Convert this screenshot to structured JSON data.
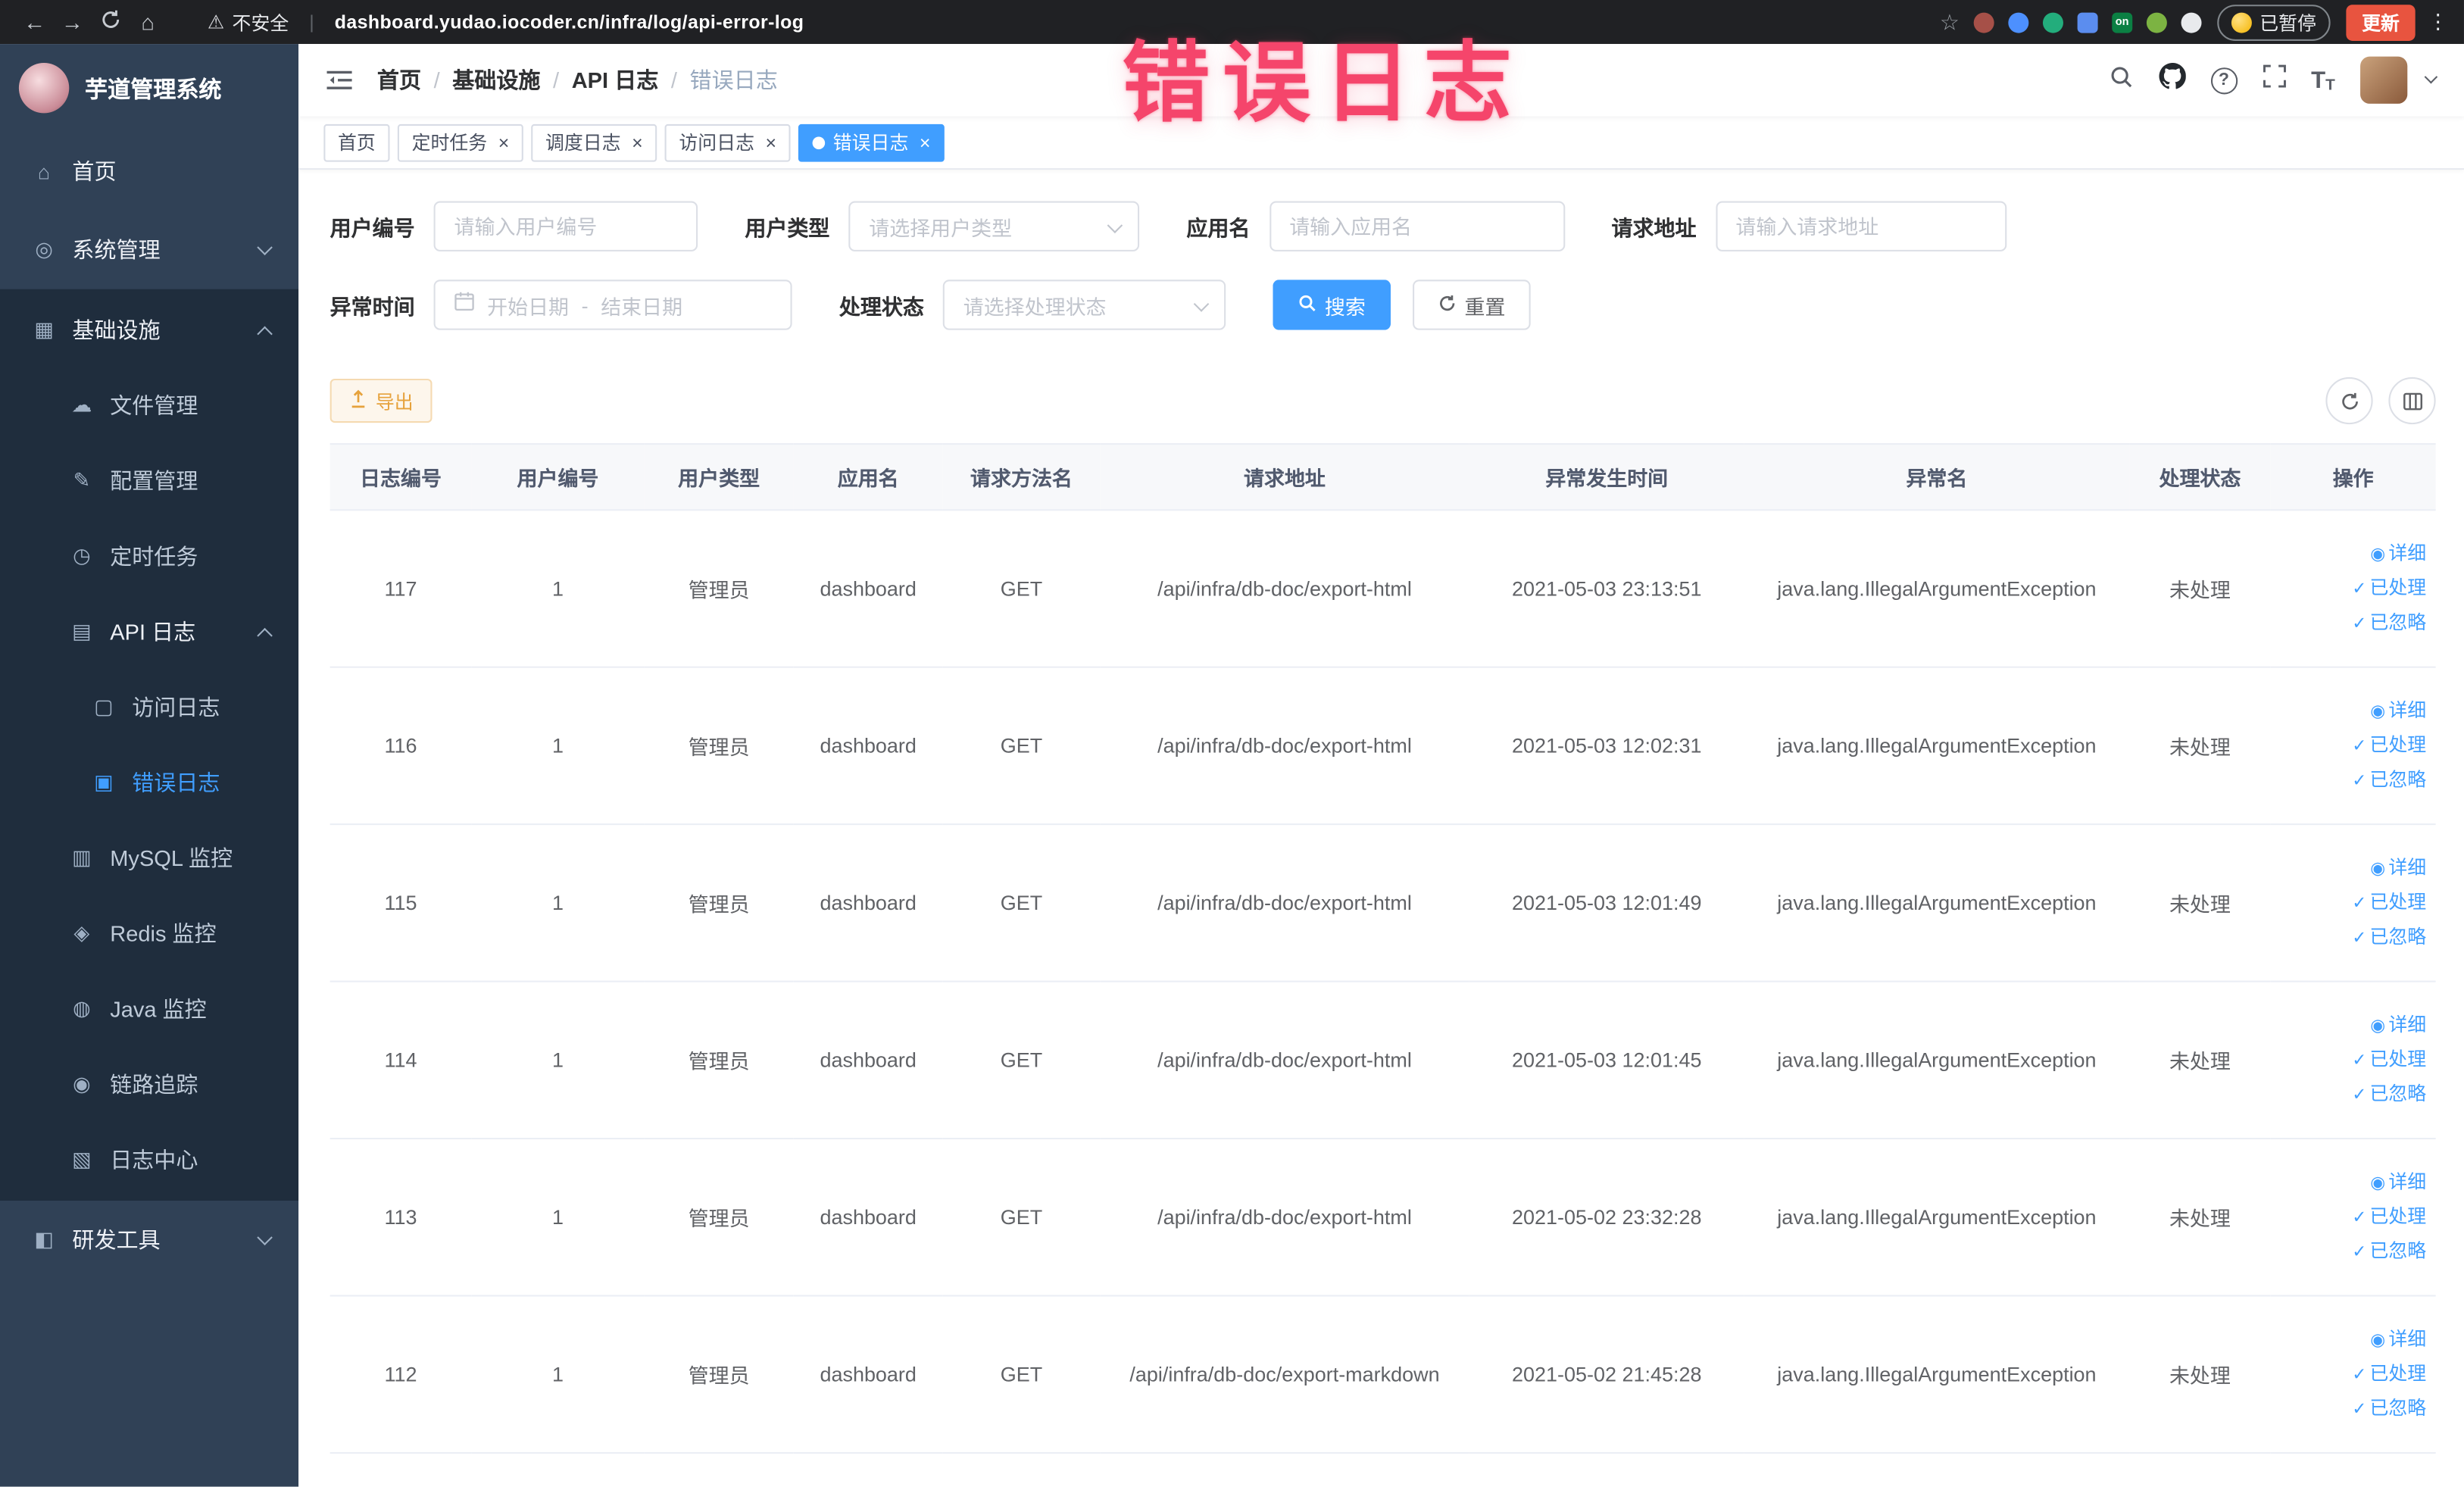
{
  "colors": {
    "accent": "#409eff",
    "warning": "#e6a23c",
    "sidebar_bg": "#304156",
    "submenu_bg": "#1f2d3d",
    "annotation": "#f5456b"
  },
  "browser": {
    "security_label": "不安全",
    "url": "dashboard.yudao.iocoder.cn/infra/log/api-error-log",
    "ext_on_label": "on",
    "paused_label": "已暂停",
    "update_label": "更新"
  },
  "overlay": {
    "title": "错误日志"
  },
  "sidebar": {
    "logo_text": "芋道管理系统",
    "items": [
      {
        "label": "首页"
      },
      {
        "label": "系统管理"
      },
      {
        "label": "基础设施"
      },
      {
        "label": "文件管理"
      },
      {
        "label": "配置管理"
      },
      {
        "label": "定时任务"
      },
      {
        "label": "API 日志"
      },
      {
        "label": "访问日志"
      },
      {
        "label": "错误日志"
      },
      {
        "label": "MySQL 监控"
      },
      {
        "label": "Redis 监控"
      },
      {
        "label": "Java 监控"
      },
      {
        "label": "链路追踪"
      },
      {
        "label": "日志中心"
      },
      {
        "label": "研发工具"
      }
    ]
  },
  "breadcrumb": {
    "separator": "/",
    "items": [
      "首页",
      "基础设施",
      "API 日志",
      "错误日志"
    ]
  },
  "tabs": [
    {
      "label": "首页"
    },
    {
      "label": "定时任务"
    },
    {
      "label": "调度日志"
    },
    {
      "label": "访问日志"
    },
    {
      "label": "错误日志"
    }
  ],
  "filters": {
    "user_id_label": "用户编号",
    "user_id_placeholder": "请输入用户编号",
    "user_type_label": "用户类型",
    "user_type_placeholder": "请选择用户类型",
    "app_name_label": "应用名",
    "app_name_placeholder": "请输入应用名",
    "request_url_label": "请求地址",
    "request_url_placeholder": "请输入请求地址",
    "exception_time_label": "异常时间",
    "start_date_placeholder": "开始日期",
    "date_separator": "-",
    "end_date_placeholder": "结束日期",
    "process_status_label": "处理状态",
    "process_status_placeholder": "请选择处理状态",
    "search_label": "搜索",
    "reset_label": "重置"
  },
  "toolbar": {
    "export_label": "导出"
  },
  "table": {
    "columns": [
      "日志编号",
      "用户编号",
      "用户类型",
      "应用名",
      "请求方法名",
      "请求地址",
      "异常发生时间",
      "异常名",
      "处理状态",
      "操作"
    ],
    "actions": [
      "详细",
      "已处理",
      "已忽略"
    ],
    "rows": [
      {
        "id": "117",
        "user_id": "1",
        "user_type": "管理员",
        "app": "dashboard",
        "method": "GET",
        "url": "/api/infra/db-doc/export-html",
        "time": "2021-05-03 23:13:51",
        "exception": "java.lang.IllegalArgumentException",
        "status": "未处理"
      },
      {
        "id": "116",
        "user_id": "1",
        "user_type": "管理员",
        "app": "dashboard",
        "method": "GET",
        "url": "/api/infra/db-doc/export-html",
        "time": "2021-05-03 12:02:31",
        "exception": "java.lang.IllegalArgumentException",
        "status": "未处理"
      },
      {
        "id": "115",
        "user_id": "1",
        "user_type": "管理员",
        "app": "dashboard",
        "method": "GET",
        "url": "/api/infra/db-doc/export-html",
        "time": "2021-05-03 12:01:49",
        "exception": "java.lang.IllegalArgumentException",
        "status": "未处理"
      },
      {
        "id": "114",
        "user_id": "1",
        "user_type": "管理员",
        "app": "dashboard",
        "method": "GET",
        "url": "/api/infra/db-doc/export-html",
        "time": "2021-05-03 12:01:45",
        "exception": "java.lang.IllegalArgumentException",
        "status": "未处理"
      },
      {
        "id": "113",
        "user_id": "1",
        "user_type": "管理员",
        "app": "dashboard",
        "method": "GET",
        "url": "/api/infra/db-doc/export-html",
        "time": "2021-05-02 23:32:28",
        "exception": "java.lang.IllegalArgumentException",
        "status": "未处理"
      },
      {
        "id": "112",
        "user_id": "1",
        "user_type": "管理员",
        "app": "dashboard",
        "method": "GET",
        "url": "/api/infra/db-doc/export-markdown",
        "time": "2021-05-02 21:45:28",
        "exception": "java.lang.IllegalArgumentException",
        "status": "未处理"
      }
    ]
  }
}
